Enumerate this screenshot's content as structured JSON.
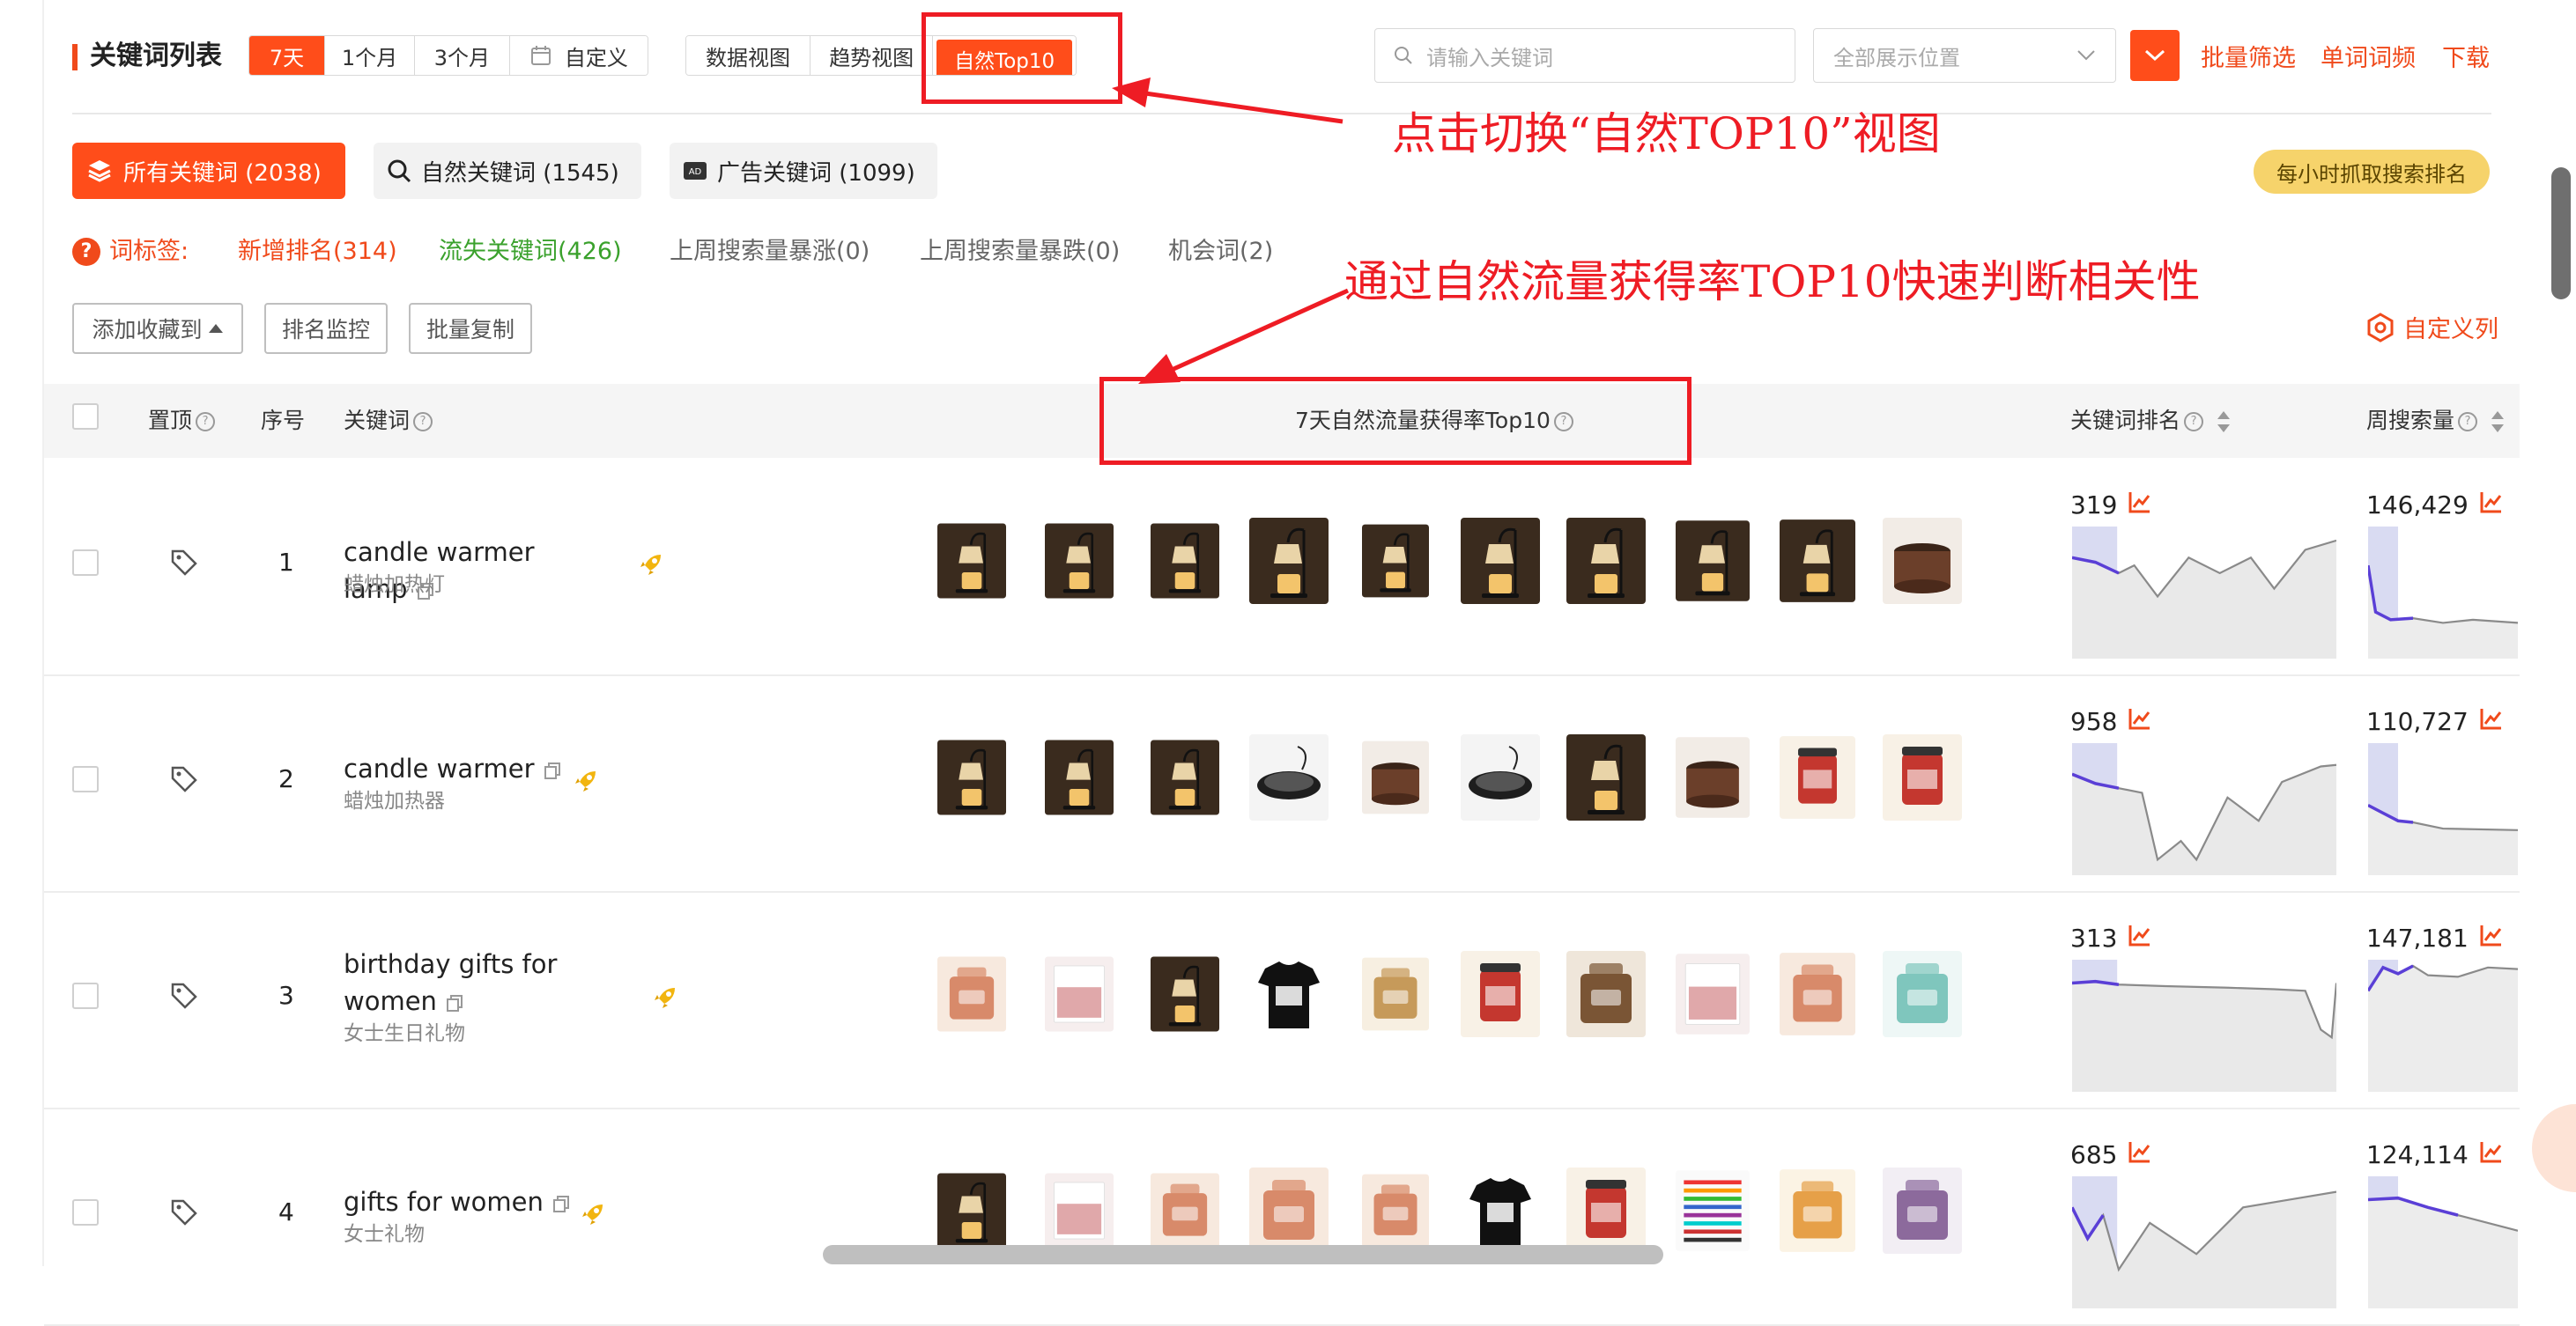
{
  "header": {
    "title": "关键词列表",
    "time_ranges": [
      "7天",
      "1个月",
      "3个月",
      "自定义"
    ],
    "time_range_active": "7天",
    "views": [
      "数据视图",
      "趋势视图",
      "自然Top10"
    ],
    "view_active": "自然Top10",
    "search_placeholder": "请输入关键词",
    "position_select": "全部展示位置",
    "links": [
      "批量筛选",
      "单词词频",
      "下载"
    ]
  },
  "keyword_tabs": [
    {
      "label": "所有关键词 (2038)",
      "active": true
    },
    {
      "label": "自然关键词 (1545)",
      "active": false
    },
    {
      "label": "广告关键词 (1099)",
      "active": false
    }
  ],
  "hourly_badge": "每小时抓取搜索排名",
  "word_tags": {
    "label": "词标签:",
    "items": [
      {
        "text": "新增排名(314)",
        "color": "#f04a1b"
      },
      {
        "text": "流失关键词(426)",
        "color": "#3aa12c"
      },
      {
        "text": "上周搜索量暴涨(0)",
        "color": "#666666"
      },
      {
        "text": "上周搜索量暴跌(0)",
        "color": "#666666"
      },
      {
        "text": "机会词(2)",
        "color": "#666666"
      }
    ]
  },
  "actions": [
    "添加收藏到",
    "排名监控",
    "批量复制"
  ],
  "custom_columns": "自定义列",
  "table": {
    "headers": {
      "pin": "置顶",
      "index": "序号",
      "keyword": "关键词",
      "top10": "7天自然流量获得率Top10",
      "rank": "关键词排名",
      "weekly": "周搜索量"
    },
    "rows": [
      {
        "index": "1",
        "keyword": "candle warmer lamp",
        "translation": "蜡烛加热灯",
        "rank": "319",
        "weekly": "146,429"
      },
      {
        "index": "2",
        "keyword": "candle warmer",
        "translation": "蜡烛加热器",
        "rank": "958",
        "weekly": "110,727"
      },
      {
        "index": "3",
        "keyword": "birthday gifts for women",
        "translation": "女士生日礼物",
        "rank": "313",
        "weekly": "147,181"
      },
      {
        "index": "4",
        "keyword": "gifts for women",
        "translation": "女士礼物",
        "rank": "685",
        "weekly": "124,114"
      }
    ]
  },
  "product_thumbs": [
    [
      "lamp",
      "lamp",
      "lamp",
      "lamp",
      "lamp",
      "lamp",
      "lamp",
      "lamp",
      "lamp",
      "warmer-pot"
    ],
    [
      "lamp",
      "lamp",
      "lamp",
      "warmer-plate",
      "warmer-pot",
      "warmer-plate",
      "lamp",
      "warmer-pot",
      "jar-candle",
      "jar-candle"
    ],
    [
      "gift-box",
      "mask",
      "lamp",
      "tshirt",
      "cookie",
      "jar-candle",
      "gift-basket",
      "mask",
      "gift-box",
      "sign"
    ],
    [
      "lamp",
      "mask",
      "gift-box",
      "gift-box",
      "gift-box",
      "tshirt",
      "jar-candle",
      "pens",
      "pillow",
      "jewelry-dish"
    ]
  ],
  "annotations": {
    "switch_view": "点击切换“自然TOP10”视图",
    "relevance": "通过自然流量获得率TOP10快速判断相关性"
  },
  "colors": {
    "accent": "#ff4d1a",
    "annotation_red": "#ee1c24",
    "trend_purple": "#5a3fd6"
  }
}
